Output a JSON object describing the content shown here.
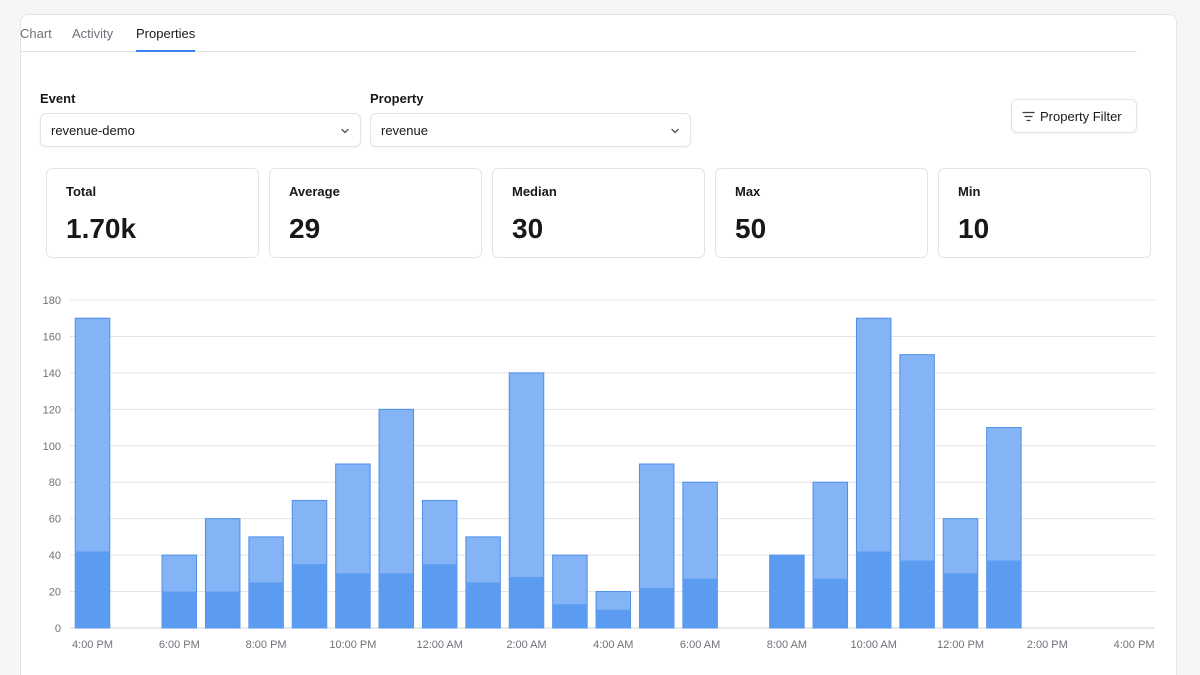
{
  "tabs": [
    {
      "label": "Chart",
      "active": false
    },
    {
      "label": "Activity",
      "active": false
    },
    {
      "label": "Properties",
      "active": true
    }
  ],
  "event": {
    "label": "Event",
    "value": "revenue-demo",
    "icon": "chevron-down-icon"
  },
  "property": {
    "label": "Property",
    "value": "revenue",
    "icon": "chevron-down-icon"
  },
  "property_filter": {
    "label": "Property Filter",
    "icon": "filter-icon"
  },
  "stats": [
    {
      "title": "Total",
      "value": "1.70k"
    },
    {
      "title": "Average",
      "value": "29"
    },
    {
      "title": "Median",
      "value": "30"
    },
    {
      "title": "Max",
      "value": "50"
    },
    {
      "title": "Min",
      "value": "10"
    }
  ],
  "colors": {
    "bar_light": "#84b3f6",
    "bar_dark": "#5b9cf1",
    "bar_border": "#4f8fe8",
    "tab_accent": "#3b82f6"
  },
  "chart_data": {
    "type": "bar",
    "stacked": false,
    "grid": true,
    "ylim": [
      0,
      180
    ],
    "yticks": [
      0,
      20,
      40,
      60,
      80,
      100,
      120,
      140,
      160,
      180
    ],
    "xlabels": [
      "4:00 PM",
      "6:00 PM",
      "8:00 PM",
      "10:00 PM",
      "12:00 AM",
      "2:00 AM",
      "4:00 AM",
      "6:00 AM",
      "8:00 AM",
      "10:00 AM",
      "12:00 PM",
      "2:00 PM",
      "4:00 PM"
    ],
    "x": [
      "4:00 PM",
      "5:00 PM",
      "6:00 PM",
      "7:00 PM",
      "8:00 PM",
      "9:00 PM",
      "10:00 PM",
      "11:00 PM",
      "12:00 AM",
      "1:00 AM",
      "2:00 AM",
      "3:00 AM",
      "4:00 AM",
      "5:00 AM",
      "6:00 AM",
      "7:00 AM",
      "8:00 AM",
      "9:00 AM",
      "10:00 AM",
      "11:00 AM",
      "12:00 PM",
      "1:00 PM",
      "2:00 PM",
      "3:00 PM"
    ],
    "series": [
      {
        "values": [
          170,
          0,
          40,
          60,
          50,
          70,
          90,
          120,
          70,
          50,
          140,
          40,
          20,
          90,
          80,
          0,
          40,
          80,
          170,
          150,
          60,
          110,
          0,
          0
        ]
      },
      {
        "values": [
          42,
          0,
          20,
          20,
          25,
          35,
          30,
          30,
          35,
          25,
          28,
          13,
          10,
          22,
          27,
          0,
          40,
          27,
          42,
          37,
          30,
          37,
          0,
          0
        ]
      }
    ]
  }
}
